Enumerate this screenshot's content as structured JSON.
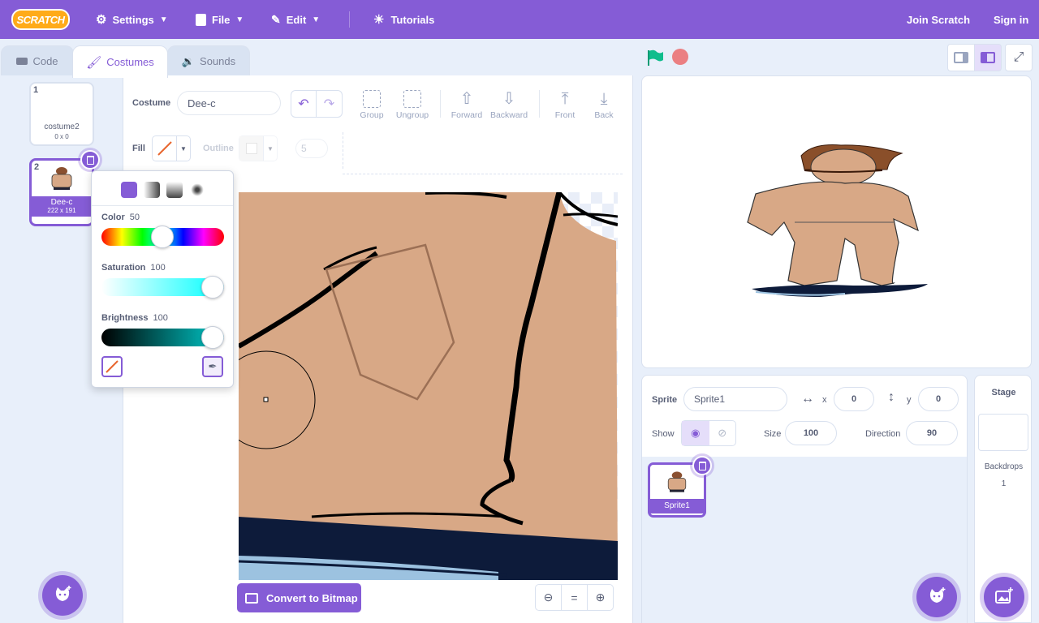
{
  "menubar": {
    "logo": "SCRATCH",
    "settings": "Settings",
    "file": "File",
    "edit": "Edit",
    "tutorials": "Tutorials",
    "join": "Join Scratch",
    "signin": "Sign in",
    "bg_color": "#855cd6"
  },
  "tabs": [
    {
      "label": "Code",
      "icon": "code-icon"
    },
    {
      "label": "Costumes",
      "icon": "brush-icon"
    },
    {
      "label": "Sounds",
      "icon": "speaker-icon"
    }
  ],
  "costumes": [
    {
      "num": "1",
      "name": "costume2",
      "size": "0 x 0"
    },
    {
      "num": "2",
      "name": "Dee-c",
      "size": "222 x 191"
    }
  ],
  "editor": {
    "costume_label": "Costume",
    "costume_name": "Dee-c",
    "tools": {
      "group": "Group",
      "ungroup": "Ungroup",
      "forward": "Forward",
      "backward": "Backward",
      "front": "Front",
      "back": "Back"
    },
    "fill_label": "Fill",
    "outline_label": "Outline",
    "outline_width": "5",
    "convert": "Convert to Bitmap",
    "zoom_reset": "="
  },
  "color_popup": {
    "color_label": "Color",
    "color_value": "50",
    "saturation_label": "Saturation",
    "saturation_value": "100",
    "brightness_label": "Brightness",
    "brightness_value": "100"
  },
  "sprite": {
    "label": "Sprite",
    "name": "Sprite1",
    "x_label": "x",
    "x": "0",
    "y_label": "y",
    "y": "0",
    "show_label": "Show",
    "size_label": "Size",
    "size": "100",
    "direction_label": "Direction",
    "direction": "90",
    "tile_name": "Sprite1"
  },
  "stage_pane": {
    "title": "Stage",
    "backdrops_label": "Backdrops",
    "backdrops_count": "1"
  },
  "colors": {
    "accent": "#855cd6",
    "skin": "#d8a886",
    "green_flag": "#0fbd8c",
    "stop": "#ec5959"
  }
}
